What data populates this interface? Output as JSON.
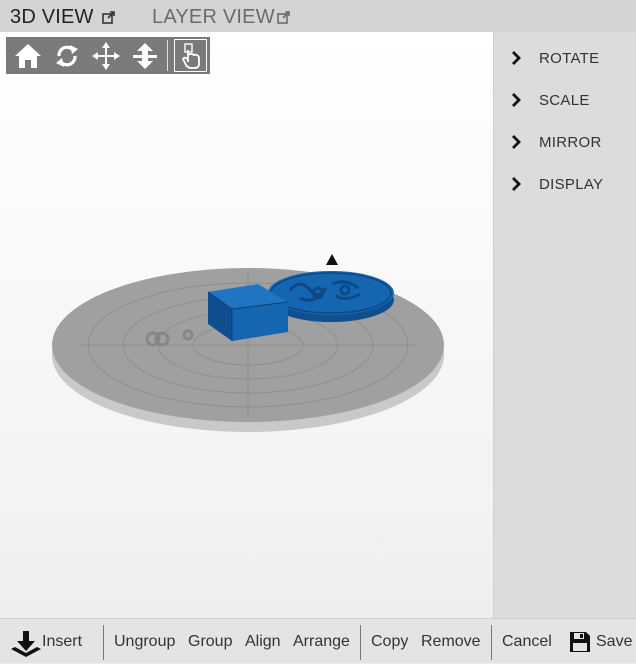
{
  "tabs": [
    {
      "label": "3D VIEW",
      "active": true,
      "icon": "popout-icon"
    },
    {
      "label": "LAYER VIEW",
      "active": false,
      "icon": "popout-icon"
    }
  ],
  "toolbar": {
    "tools": [
      {
        "name": "home-icon"
      },
      {
        "name": "rotate-icon"
      },
      {
        "name": "move-icon"
      },
      {
        "name": "lay-flat-icon"
      },
      {
        "name": "select-hand-icon",
        "selected": true
      }
    ]
  },
  "panel": {
    "items": [
      {
        "label": "ROTATE",
        "icon": "chevron-right-icon"
      },
      {
        "label": "SCALE",
        "icon": "chevron-right-icon"
      },
      {
        "label": "MIRROR",
        "icon": "chevron-right-icon"
      },
      {
        "label": "DISPLAY",
        "icon": "chevron-right-icon"
      }
    ]
  },
  "actions": {
    "insert": "Insert",
    "ungroup": "Ungroup",
    "group": "Group",
    "align": "Align",
    "arrange": "Arrange",
    "copy": "Copy",
    "remove": "Remove",
    "cancel": "Cancel",
    "save": "Save"
  },
  "colors": {
    "object_blue": "#1565b0",
    "bed_grey": "#9e9e9e",
    "toolbar_grey": "#7a7a7a",
    "panel_grey": "#dcdcdc"
  }
}
